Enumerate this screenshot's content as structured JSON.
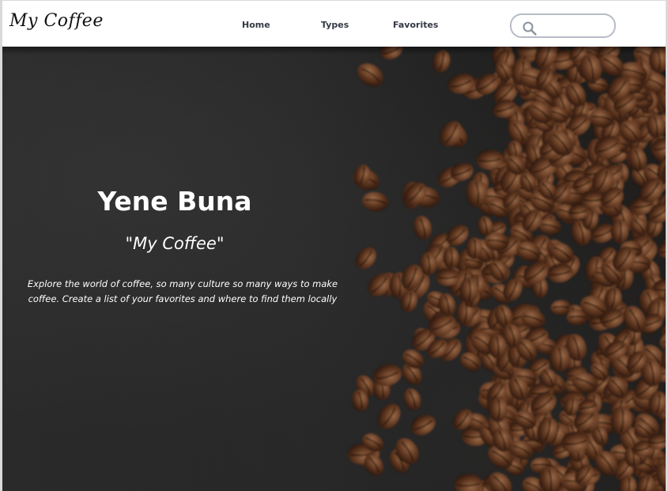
{
  "header": {
    "logo": "My Coffee",
    "nav": [
      {
        "label": "Home"
      },
      {
        "label": "Types"
      },
      {
        "label": "Favorites"
      }
    ],
    "search": {
      "value": "",
      "placeholder": ""
    }
  },
  "hero": {
    "title": "Yene Buna",
    "subtitle": "\"My Coffee\"",
    "description": "Explore the world of coffee, so many culture so many ways to make coffee. Create a list of your favorites and where to find them locally",
    "background_image": "coffee-beans-on-dark-surface"
  },
  "colors": {
    "nav_text": "#333a44",
    "search_border": "#b6bcc6",
    "hero_background": "#262626",
    "hero_text": "#ffffff",
    "bean_color": "#5a3420"
  }
}
